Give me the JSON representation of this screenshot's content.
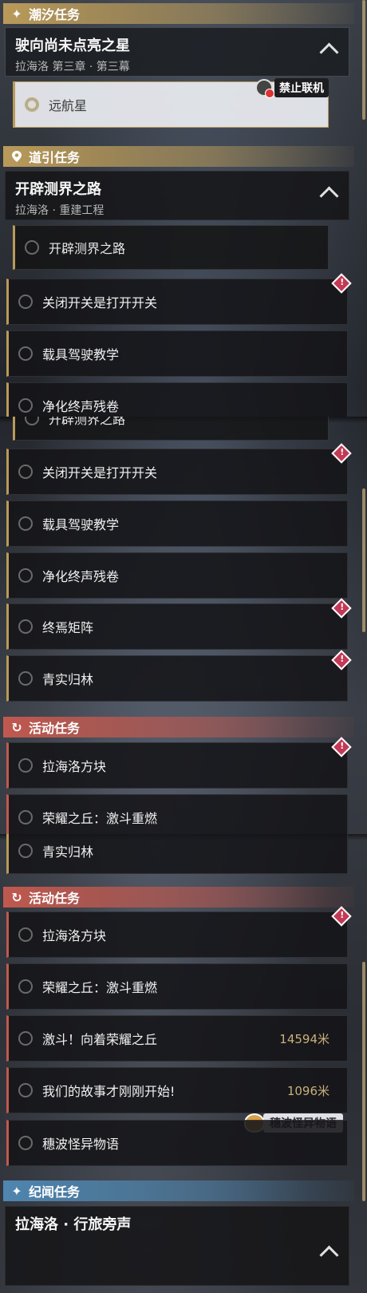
{
  "cat_tide": "潮汐任务",
  "cat_guide": "道引任务",
  "cat_event": "活动任务",
  "cat_record": "纪闻任务",
  "tide_quest": {
    "title": "驶向尚未点亮之星",
    "subtitle": "拉海洛 第三章 · 第三幕",
    "step": "远航星",
    "badge": "禁止联机"
  },
  "guide_quest": {
    "title": "开辟测界之路",
    "subtitle": "拉海洛 · 重建工程",
    "step": "开辟测界之路"
  },
  "guide_items": [
    "关闭开关是打开开关",
    "载具驾驶教学",
    "净化终声残卷",
    "终焉矩阵",
    "青实归林"
  ],
  "event_items": [
    "拉海洛方块",
    "荣耀之丘：激斗重燃",
    "激斗！向着荣耀之丘",
    "我们的故事才刚刚开始!",
    "穗波怪异物语"
  ],
  "event_distances": [
    "14594米",
    "1096米"
  ],
  "event_badge": "穗波怪异物语",
  "record_quest": {
    "title": "拉海洛 · 行旅旁声"
  },
  "colors": {
    "gold": "#b99a5a",
    "red": "#c0594f",
    "blue": "#4f86b0",
    "alert": "#c33a56"
  }
}
